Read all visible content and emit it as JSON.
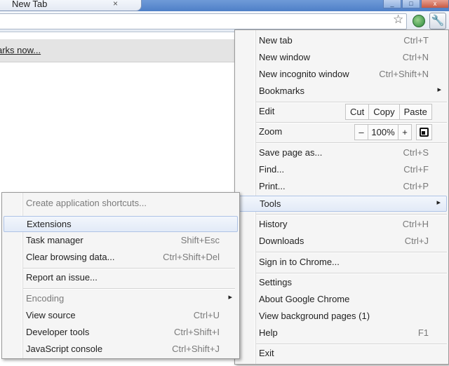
{
  "tab": {
    "title": "New Tab",
    "close_glyph": "×"
  },
  "window_buttons": {
    "minimize": "_",
    "maximize": "□",
    "close": "x"
  },
  "bookmark_bar": {
    "link_text": "arks now..."
  },
  "main_menu": {
    "new_tab": {
      "label": "New tab",
      "shortcut": "Ctrl+T"
    },
    "new_window": {
      "label": "New window",
      "shortcut": "Ctrl+N"
    },
    "new_incognito": {
      "label": "New incognito window",
      "shortcut": "Ctrl+Shift+N"
    },
    "bookmarks": {
      "label": "Bookmarks"
    },
    "edit": {
      "label": "Edit",
      "cut": "Cut",
      "copy": "Copy",
      "paste": "Paste"
    },
    "zoom": {
      "label": "Zoom",
      "minus": "–",
      "value": "100%",
      "plus": "+"
    },
    "save_page": {
      "label": "Save page as...",
      "shortcut": "Ctrl+S"
    },
    "find": {
      "label": "Find...",
      "shortcut": "Ctrl+F"
    },
    "print": {
      "label": "Print...",
      "shortcut": "Ctrl+P"
    },
    "tools": {
      "label": "Tools"
    },
    "history": {
      "label": "History",
      "shortcut": "Ctrl+H"
    },
    "downloads": {
      "label": "Downloads",
      "shortcut": "Ctrl+J"
    },
    "sign_in": {
      "label": "Sign in to Chrome..."
    },
    "settings": {
      "label": "Settings"
    },
    "about": {
      "label": "About Google Chrome"
    },
    "background_pages": {
      "label": "View background pages (1)"
    },
    "help": {
      "label": "Help",
      "shortcut": "F1"
    },
    "exit": {
      "label": "Exit"
    }
  },
  "tools_menu": {
    "create_shortcuts": {
      "label": "Create application shortcuts..."
    },
    "extensions": {
      "label": "Extensions"
    },
    "task_manager": {
      "label": "Task manager",
      "shortcut": "Shift+Esc"
    },
    "clear_browsing": {
      "label": "Clear browsing data...",
      "shortcut": "Ctrl+Shift+Del"
    },
    "report_issue": {
      "label": "Report an issue..."
    },
    "encoding": {
      "label": "Encoding"
    },
    "view_source": {
      "label": "View source",
      "shortcut": "Ctrl+U"
    },
    "developer_tools": {
      "label": "Developer tools",
      "shortcut": "Ctrl+Shift+I"
    },
    "js_console": {
      "label": "JavaScript console",
      "shortcut": "Ctrl+Shift+J"
    }
  },
  "icons": {
    "star": "☆",
    "wrench": "🔧",
    "submenu_arrow": "▸"
  }
}
